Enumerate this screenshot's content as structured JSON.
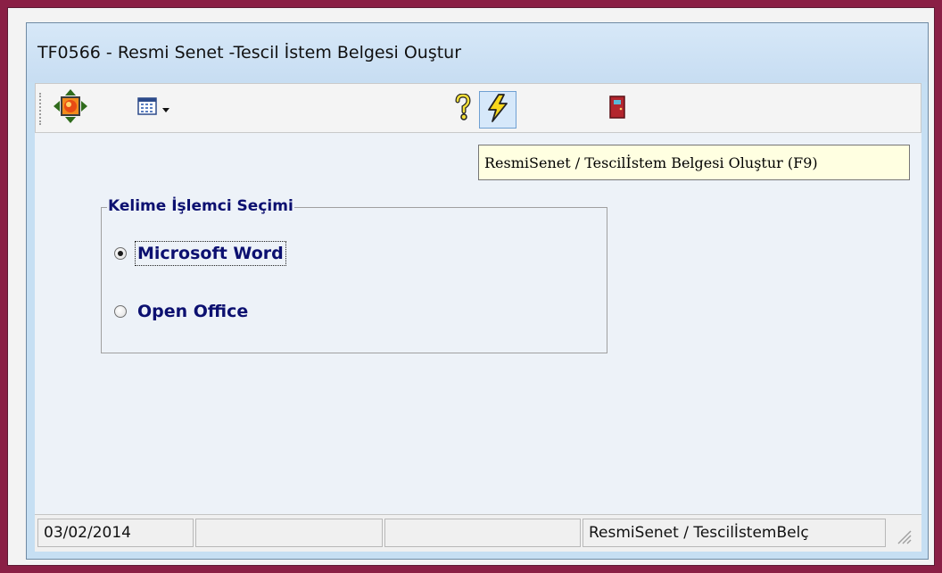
{
  "window": {
    "title": "TF0566 - Resmi Senet -Tescil İstem Belgesi Ouştur"
  },
  "toolbar": {
    "buttons": [
      {
        "icon": "navigation-icon"
      },
      {
        "icon": "calendar-icon"
      },
      {
        "icon": "help-icon"
      },
      {
        "icon": "lightning-icon"
      },
      {
        "icon": "exit-door-icon"
      }
    ]
  },
  "tooltip": {
    "text": "ResmiSenet / Tescilİstem Belgesi Oluştur (F9)"
  },
  "group": {
    "label": "Kelime İşlemci Seçimi",
    "options": [
      {
        "label": "Microsoft Word",
        "selected": true
      },
      {
        "label": "Open Office",
        "selected": false
      }
    ]
  },
  "status": {
    "date": "03/02/2014",
    "message": "ResmiSenet / TescilİstemBelç"
  },
  "colors": {
    "label_text": "#0c1070",
    "window_bg": "#edf2f8",
    "outer_border": "#8a1f45"
  }
}
